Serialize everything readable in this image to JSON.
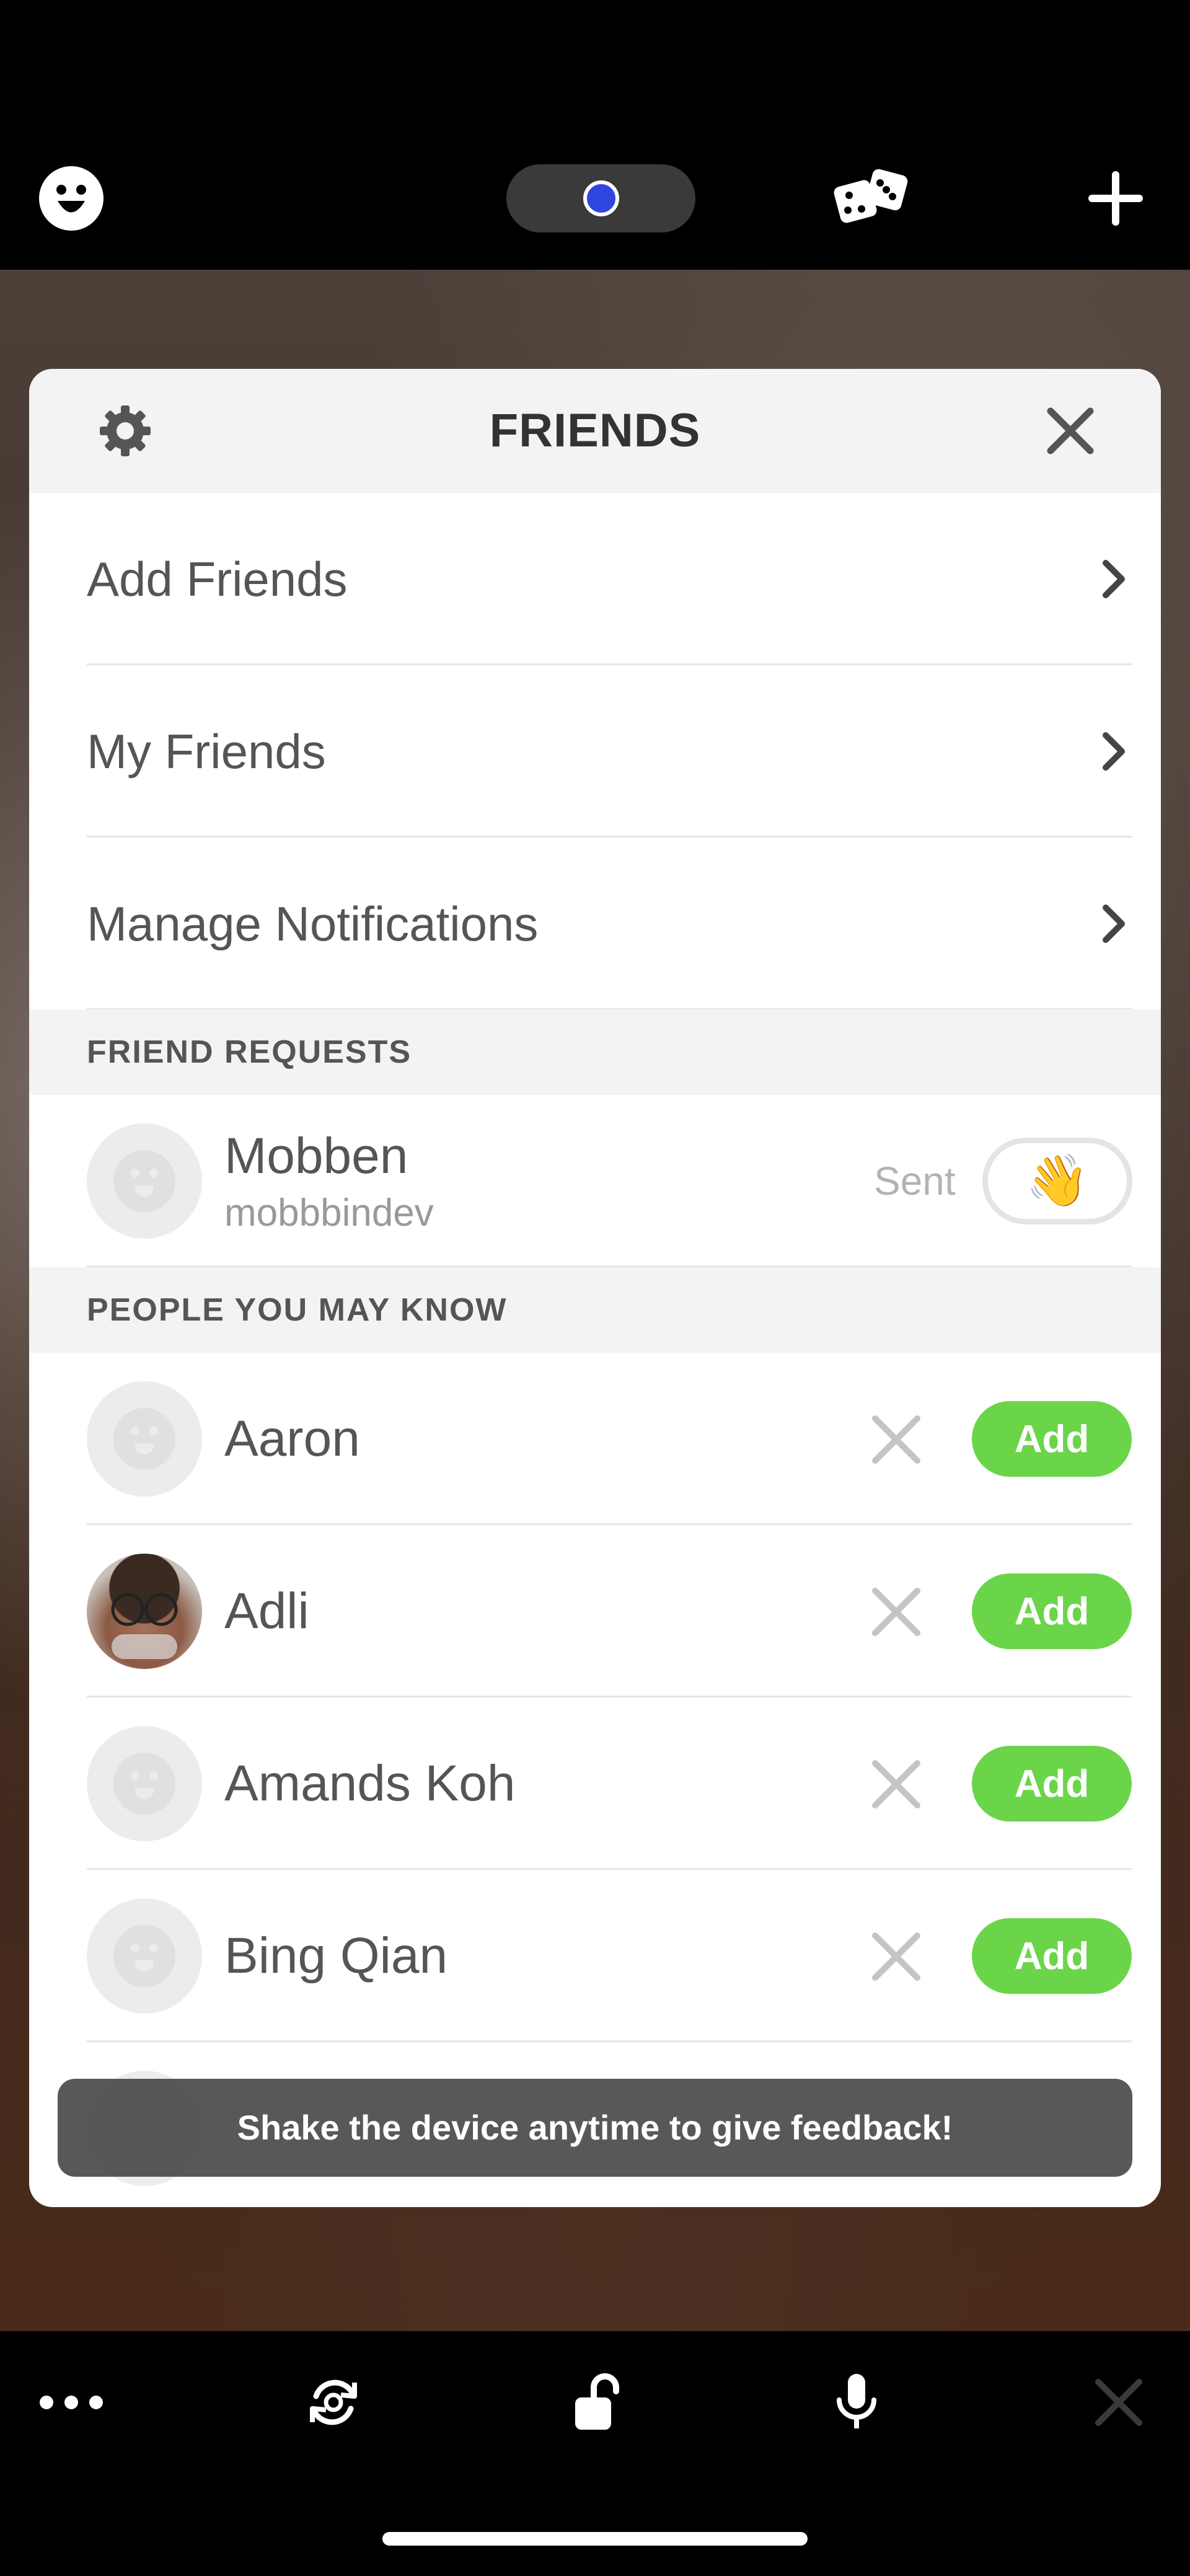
{
  "modal": {
    "title": "FRIENDS",
    "menu_items": [
      {
        "label": "Add Friends"
      },
      {
        "label": "My Friends"
      },
      {
        "label": "Manage Notifications"
      }
    ]
  },
  "friend_requests": {
    "header": "FRIEND REQUESTS",
    "items": [
      {
        "name": "Mobben",
        "username": "mobbbindev",
        "status": "Sent",
        "action_emoji": "👋"
      }
    ]
  },
  "people_you_may_know": {
    "header": "PEOPLE YOU MAY KNOW",
    "add_label": "Add",
    "items": [
      {
        "name": "Aaron",
        "avatar": "default"
      },
      {
        "name": "Adli",
        "avatar": "photo"
      },
      {
        "name": "Amands Koh",
        "avatar": "default"
      },
      {
        "name": "Bing Qian",
        "avatar": "default"
      }
    ]
  },
  "toast": {
    "text": "Shake the device anytime to give feedback!"
  },
  "colors": {
    "accent_green": "#6bd54a",
    "record_dot": "#2f46e0"
  },
  "icons": {
    "top": [
      "smiley-face-icon",
      "record-dot-icon",
      "dice-icon",
      "plus-icon"
    ],
    "bottom": [
      "more-dots-icon",
      "switch-camera-icon",
      "unlock-icon",
      "microphone-icon",
      "close-icon"
    ]
  }
}
